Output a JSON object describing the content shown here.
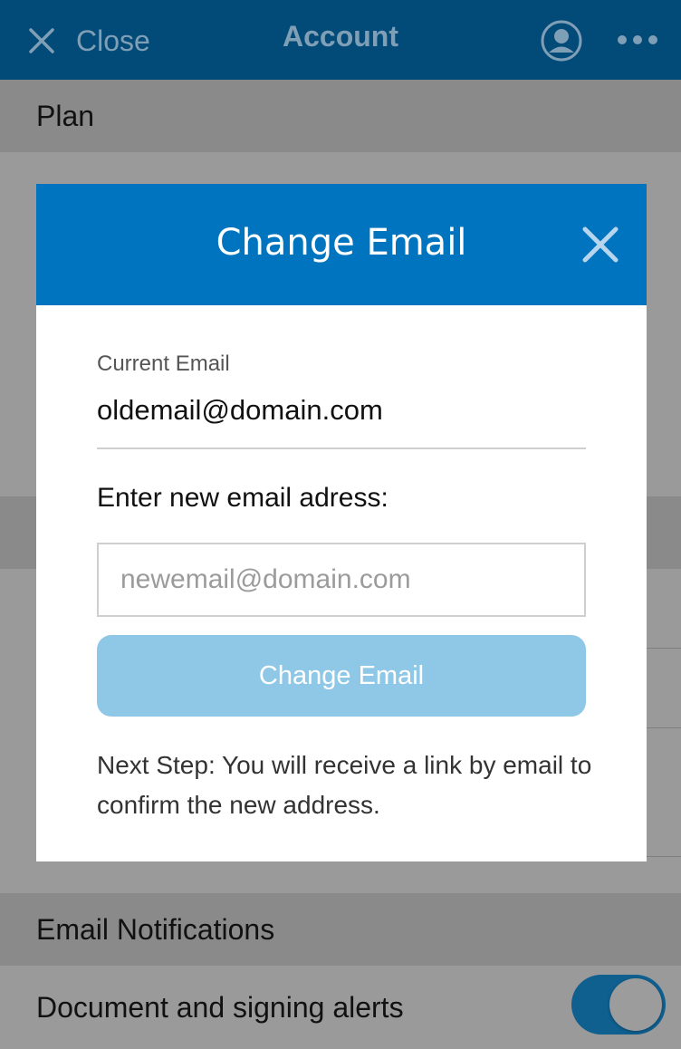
{
  "navbar": {
    "close_label": "Close",
    "title": "Account",
    "icons": [
      "close-icon",
      "profile-icon",
      "more-icon"
    ]
  },
  "background": {
    "plan_header": "Plan",
    "email_notifications_header": "Email Notifications",
    "document_alerts_label": "Document and signing alerts",
    "document_alerts_on": true
  },
  "modal": {
    "title": "Change Email",
    "current_email_label": "Current Email",
    "current_email_value": "oldemail@domain.com",
    "new_email_label": "Enter new email adress:",
    "new_email_placeholder": "newemail@domain.com",
    "new_email_value": "",
    "submit_label": "Change Email",
    "next_step_text": "Next Step: You will receive a link by email to confirm the new address."
  },
  "colors": {
    "navbar": "#024a78",
    "modal_header": "#0074bf",
    "button_disabled": "#8fc8e7",
    "toggle_on": "#0f5f8f"
  }
}
